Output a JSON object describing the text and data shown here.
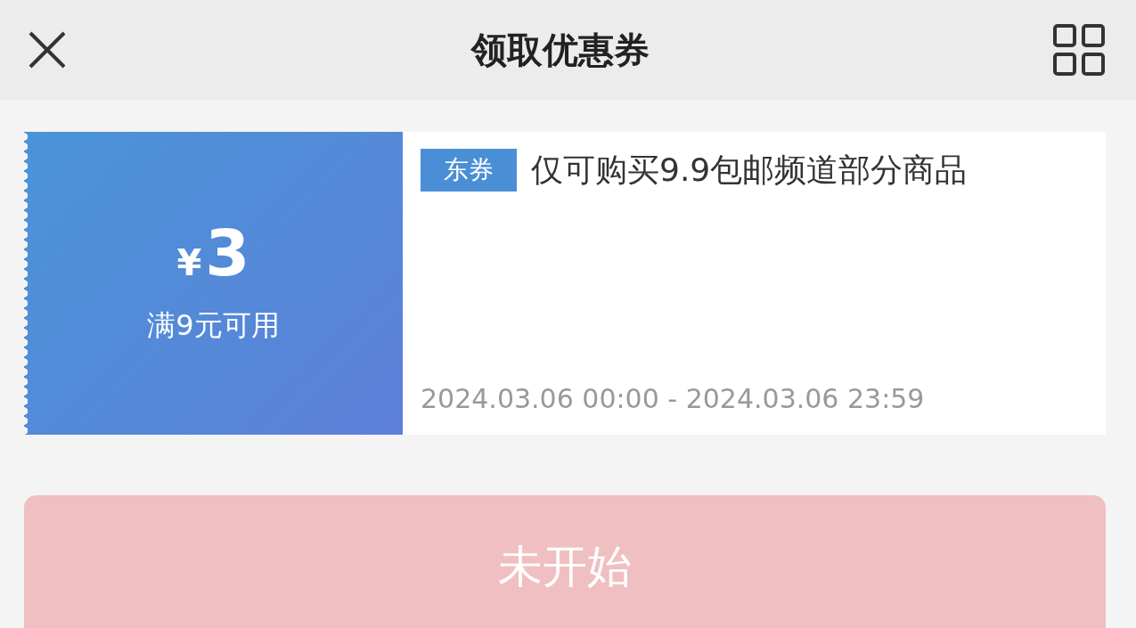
{
  "header": {
    "title": "领取优惠券"
  },
  "coupon": {
    "symbol": "¥",
    "amount": "3",
    "condition": "满9元可用",
    "tag": "东券",
    "description": "仅可购买9.9包邮频道部分商品",
    "validity": "2024.03.06 00:00 - 2024.03.06 23:59"
  },
  "action_button": {
    "label": "未开始",
    "disabled": true
  }
}
